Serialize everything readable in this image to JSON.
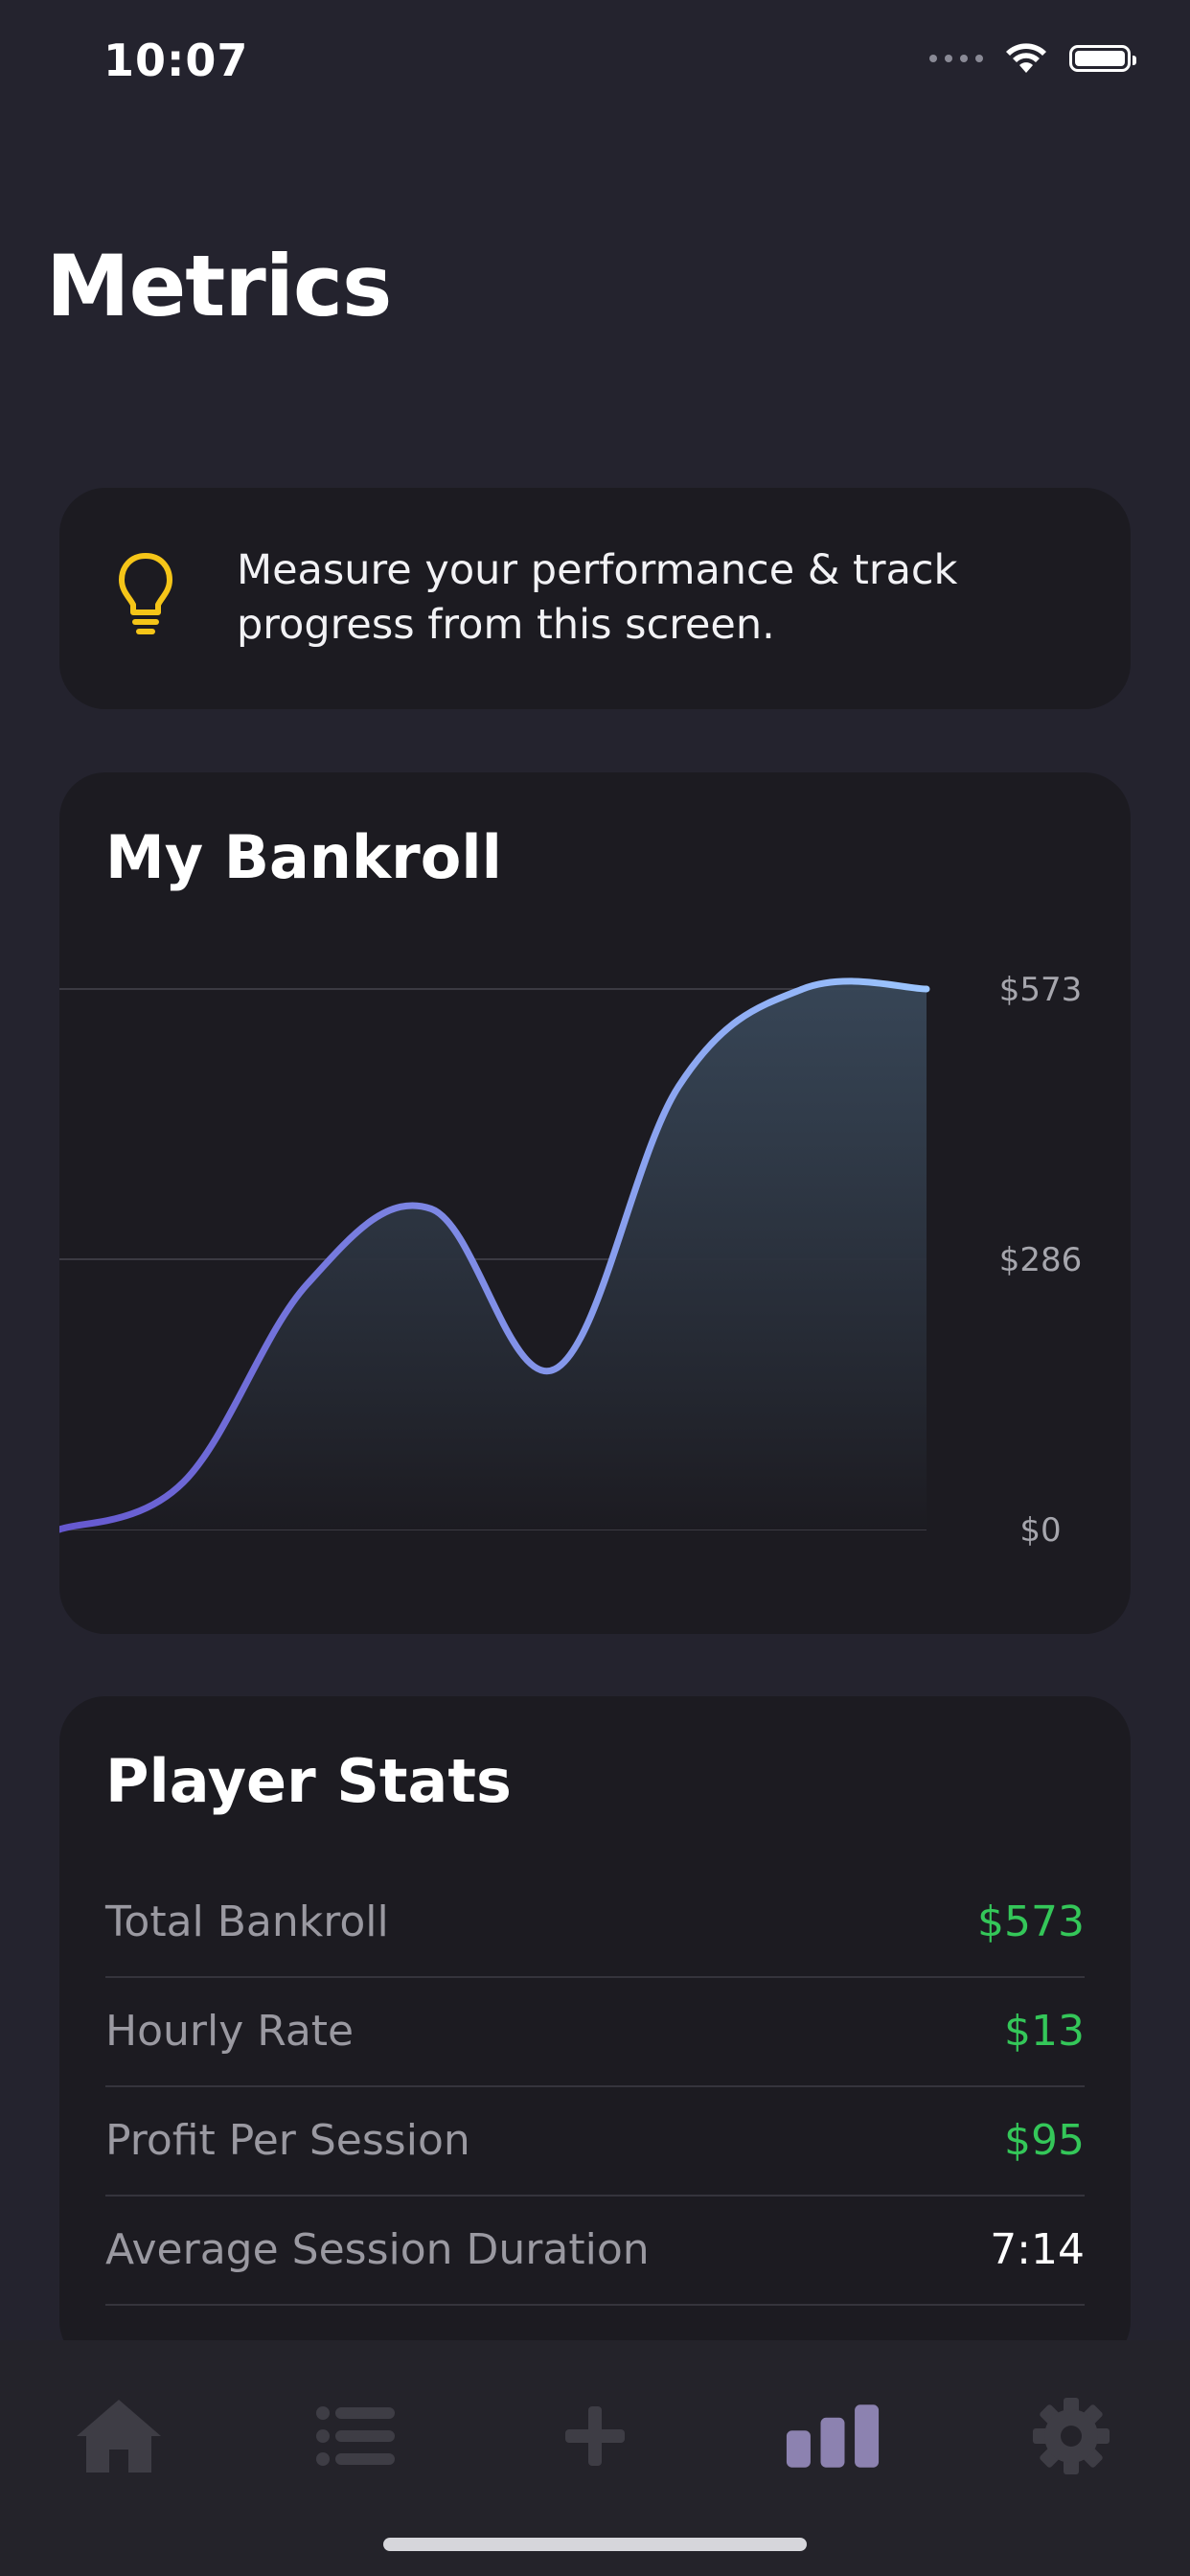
{
  "status_bar": {
    "time": "10:07"
  },
  "page": {
    "title": "Metrics"
  },
  "tip": {
    "icon": "lightbulb-icon",
    "text": "Measure your performance & track progress from this screen."
  },
  "bankroll": {
    "title": "My Bankroll"
  },
  "chart_data": {
    "type": "area",
    "title": "My Bankroll",
    "x": [
      0,
      1,
      2,
      3,
      4,
      5,
      6,
      7
    ],
    "values": [
      0,
      50,
      260,
      340,
      170,
      470,
      573,
      573
    ],
    "y_tick_labels": [
      "$573",
      "$286",
      "$0"
    ],
    "ylim": [
      0,
      573
    ],
    "grid": true,
    "colors": {
      "line_start": "#6557cf",
      "line_end": "#9cc6ff",
      "fill_top": "#3a4a5c",
      "fill_bottom": "#1c1b21"
    }
  },
  "stats": {
    "title": "Player Stats",
    "rows": [
      {
        "label": "Total Bankroll",
        "value": "$573"
      },
      {
        "label": "Hourly Rate",
        "value": "$13"
      },
      {
        "label": "Profit Per Session",
        "value": "$95"
      },
      {
        "label": "Average Session Duration",
        "value": "7:14"
      }
    ]
  },
  "tabbar": {
    "items": [
      {
        "icon": "home-icon",
        "active": false
      },
      {
        "icon": "list-icon",
        "active": false
      },
      {
        "icon": "plus-icon",
        "active": false
      },
      {
        "icon": "bar-chart-icon",
        "active": true
      },
      {
        "icon": "gear-icon",
        "active": false
      }
    ],
    "colors": {
      "active": "#8c82b0",
      "inactive": "#3e3d45"
    }
  }
}
